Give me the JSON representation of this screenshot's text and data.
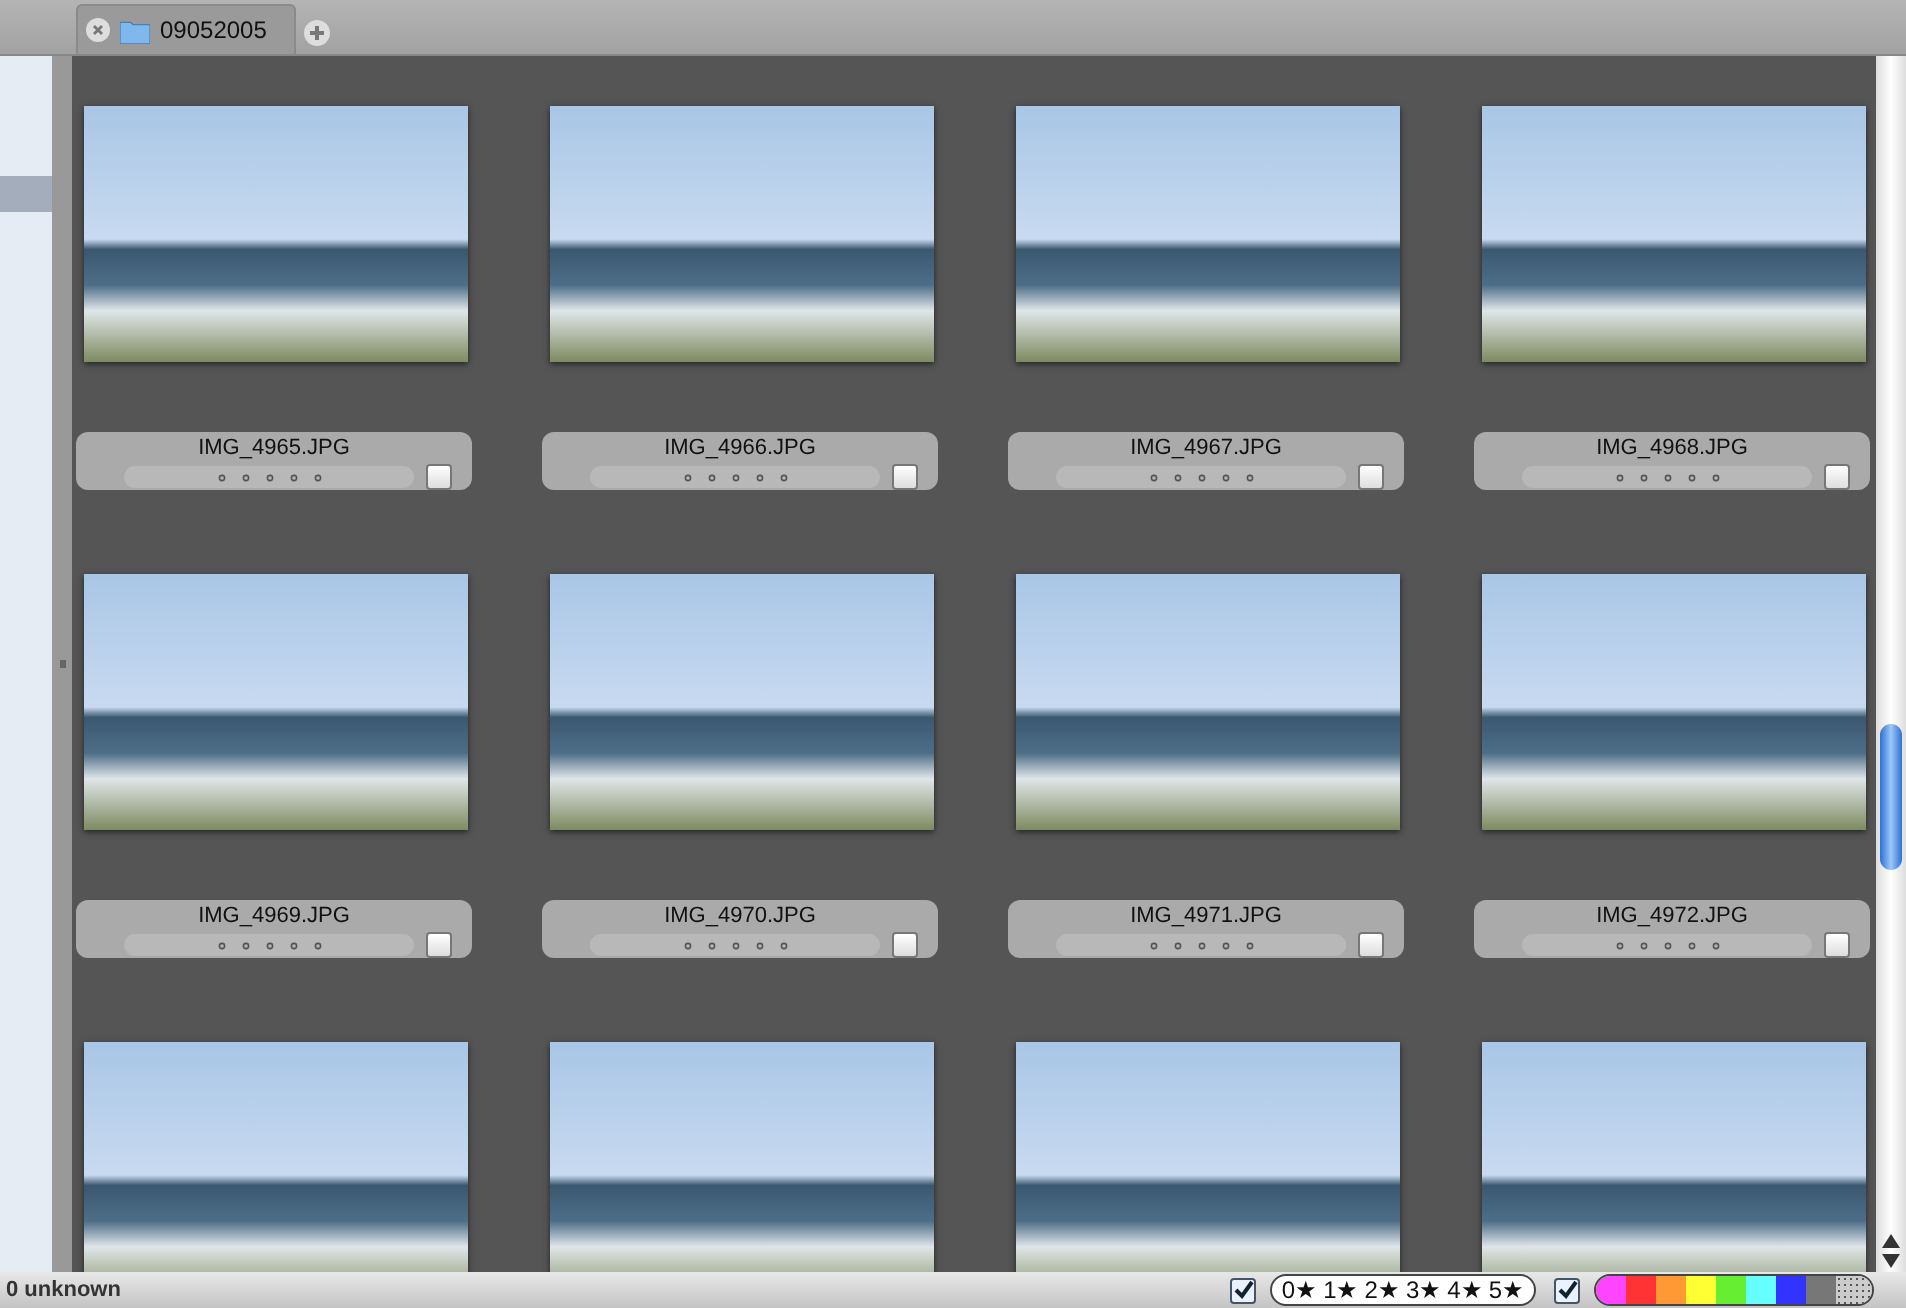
{
  "tabs": [
    {
      "label": "09052005",
      "selected": true
    }
  ],
  "thumbnails": [
    {
      "kind": "captioned",
      "name": "IMG_4965.JPG",
      "stars": 0,
      "checked": false
    },
    {
      "kind": "captioned",
      "name": "IMG_4966.JPG",
      "stars": 0,
      "checked": false
    },
    {
      "kind": "captioned",
      "name": "IMG_4967.JPG",
      "stars": 0,
      "checked": false
    },
    {
      "kind": "captioned",
      "name": "IMG_4968.JPG",
      "stars": 0,
      "checked": false
    },
    {
      "kind": "captioned",
      "name": "IMG_4969.JPG",
      "stars": 0,
      "checked": false
    },
    {
      "kind": "captioned",
      "name": "IMG_4970.JPG",
      "stars": 0,
      "checked": false
    },
    {
      "kind": "captioned",
      "name": "IMG_4971.JPG",
      "stars": 0,
      "checked": false
    },
    {
      "kind": "captioned",
      "name": "IMG_4972.JPG",
      "stars": 0,
      "checked": false
    },
    {
      "kind": "photo"
    },
    {
      "kind": "photo"
    },
    {
      "kind": "photo"
    },
    {
      "kind": "photo"
    }
  ],
  "status_bar": {
    "text": "0 unknown",
    "rating_filter_checked": true,
    "rating_filter": [
      {
        "label": "0★",
        "selected": false
      },
      {
        "label": "1★",
        "selected": false
      },
      {
        "label": "2★",
        "selected": false
      },
      {
        "label": "3★",
        "selected": false
      },
      {
        "label": "4★",
        "selected": false
      },
      {
        "label": "5★",
        "selected": false
      }
    ],
    "color_filter_checked": true,
    "color_filter": [
      {
        "kind": "color",
        "color": "#ff44ff"
      },
      {
        "kind": "color",
        "color": "#ff3333"
      },
      {
        "kind": "color",
        "color": "#ff9933"
      },
      {
        "kind": "color",
        "color": "#ffff33"
      },
      {
        "kind": "color",
        "color": "#66ee33"
      },
      {
        "kind": "color",
        "color": "#66ffff"
      },
      {
        "kind": "color",
        "color": "#3333ff"
      },
      {
        "kind": "color",
        "color": "#777777"
      },
      {
        "kind": "any"
      }
    ]
  }
}
